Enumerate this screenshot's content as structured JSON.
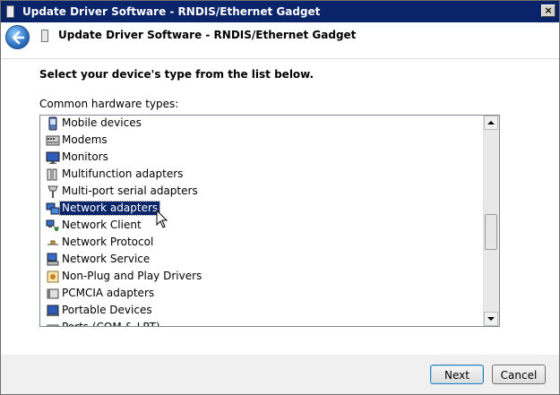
{
  "window": {
    "title": "Update Driver Software - RNDIS/Ethernet Gadget",
    "close_glyph": "×"
  },
  "header": {
    "title": "Update Driver Software - RNDIS/Ethernet Gadget"
  },
  "main": {
    "instruction": "Select your device's type from the list below.",
    "list_label": "Common hardware types:",
    "selected_index": 5,
    "items": [
      {
        "label": "Mobile devices",
        "icon": "mobile-device-icon"
      },
      {
        "label": "Modems",
        "icon": "modem-icon"
      },
      {
        "label": "Monitors",
        "icon": "monitor-icon"
      },
      {
        "label": "Multifunction adapters",
        "icon": "multifunction-adapter-icon"
      },
      {
        "label": "Multi-port serial adapters",
        "icon": "serial-adapter-icon"
      },
      {
        "label": "Network adapters",
        "icon": "network-adapter-icon"
      },
      {
        "label": "Network Client",
        "icon": "network-client-icon"
      },
      {
        "label": "Network Protocol",
        "icon": "network-protocol-icon"
      },
      {
        "label": "Network Service",
        "icon": "network-service-icon"
      },
      {
        "label": "Non-Plug and Play Drivers",
        "icon": "non-pnp-driver-icon"
      },
      {
        "label": "PCMCIA adapters",
        "icon": "pcmcia-adapter-icon"
      },
      {
        "label": "Portable Devices",
        "icon": "portable-device-icon"
      },
      {
        "label": "Ports (COM & LPT)",
        "icon": "port-icon"
      }
    ]
  },
  "footer": {
    "next_label": "Next",
    "cancel_label": "Cancel"
  },
  "colors": {
    "selection": "#0a246a",
    "titlebar": "#0a246a"
  }
}
